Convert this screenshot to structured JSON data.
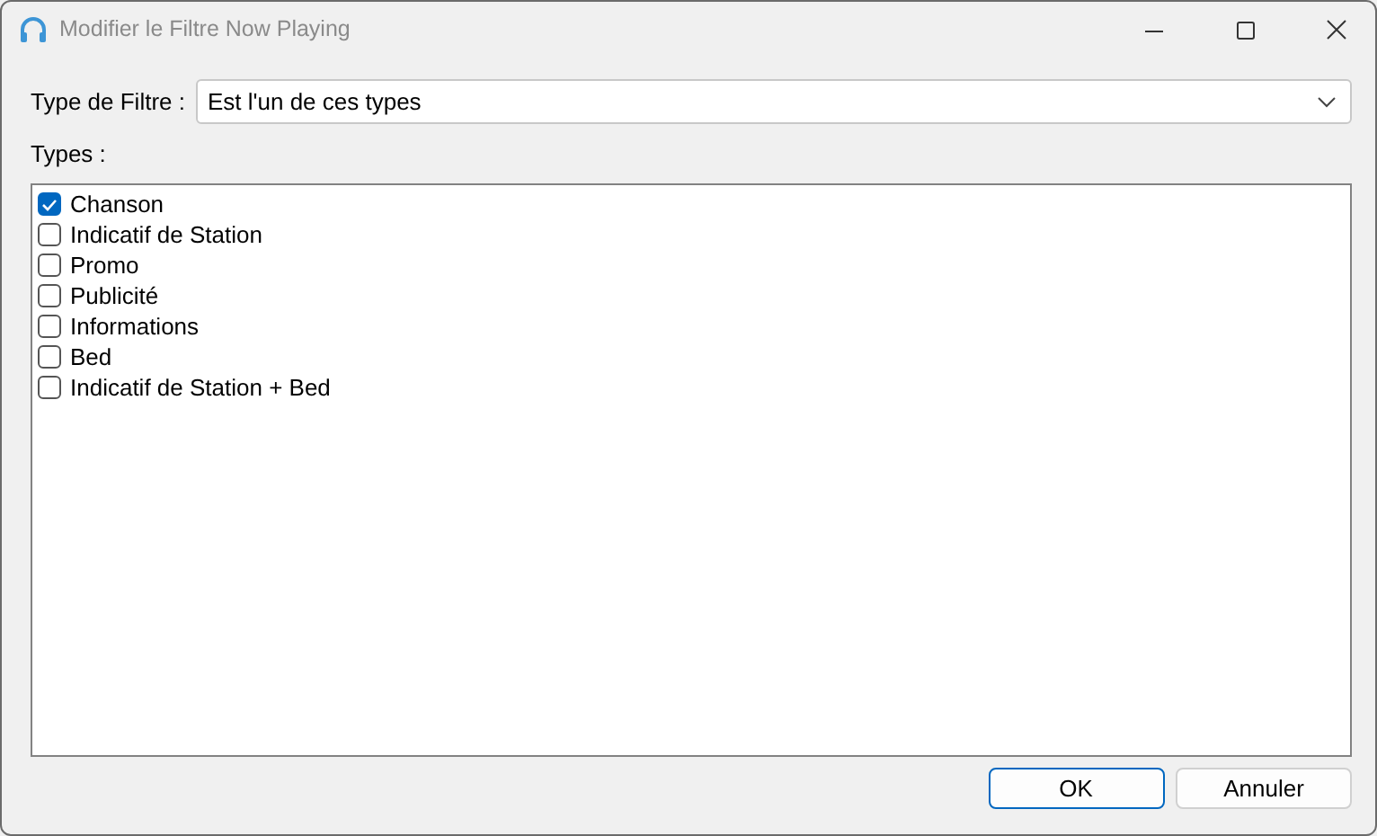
{
  "window": {
    "title": "Modifier le Filtre Now Playing"
  },
  "filter": {
    "label": "Type de Filtre :",
    "value": "Est l'un de ces types"
  },
  "types": {
    "label": "Types :",
    "items": [
      {
        "label": "Chanson",
        "checked": true
      },
      {
        "label": "Indicatif de Station",
        "checked": false
      },
      {
        "label": "Promo",
        "checked": false
      },
      {
        "label": "Publicité",
        "checked": false
      },
      {
        "label": "Informations",
        "checked": false
      },
      {
        "label": "Bed",
        "checked": false
      },
      {
        "label": "Indicatif de Station + Bed",
        "checked": false
      }
    ]
  },
  "buttons": [
    {
      "label": "OK",
      "default": true
    },
    {
      "label": "Annuler",
      "default": false
    }
  ]
}
